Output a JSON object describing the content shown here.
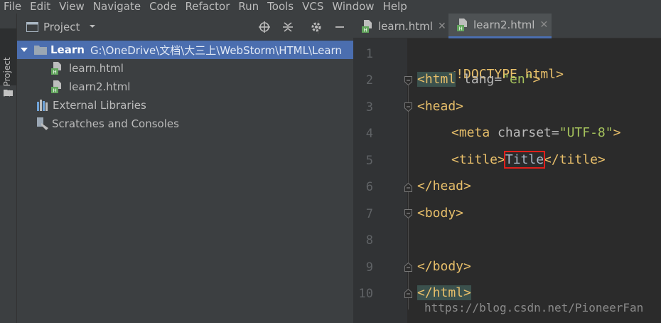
{
  "menubar": {
    "items": [
      "File",
      "Edit",
      "View",
      "Navigate",
      "Code",
      "Refactor",
      "Run",
      "Tools",
      "VCS",
      "Window",
      "Help"
    ]
  },
  "toolstrip": {
    "project_tab": "1: Project"
  },
  "project_panel": {
    "title": "Project",
    "tree": {
      "root_name": "Learn",
      "root_path": "G:\\OneDrive\\文档\\大三上\\WebStorm\\HTML\\Learn",
      "files": [
        "learn.html",
        "learn2.html"
      ],
      "external_libraries": "External Libraries",
      "scratches": "Scratches and Consoles"
    }
  },
  "editor": {
    "tabs": [
      {
        "label": "learn.html",
        "active": false
      },
      {
        "label": "learn2.html",
        "active": true
      }
    ],
    "line_numbers": [
      "1",
      "2",
      "3",
      "4",
      "5",
      "6",
      "7",
      "8",
      "9",
      "10"
    ],
    "code": {
      "l1": "<!DOCTYPE html>",
      "l2_tag_open": "<html",
      "l2_attr": " lang=",
      "l2_val": "\"en\"",
      "l2_close": ">",
      "l3": "<head>",
      "l4_tag": "<meta",
      "l4_attr": " charset=",
      "l4_val": "\"UTF-8\"",
      "l4_close": ">",
      "l5_open": "<title>",
      "l5_text": "Title",
      "l5_close": "</title>",
      "l6": "</head>",
      "l7": "<body>",
      "l9": "</body>",
      "l10": "</html>"
    },
    "watermark": "https://blog.csdn.net/PioneerFan"
  },
  "colors": {
    "background": "#2b2b2b",
    "panel": "#3c3f41",
    "selection": "#4b6eaf",
    "tag": "#e8bf6a",
    "string": "#a5c25c",
    "highlight_box": "#e0201b"
  }
}
